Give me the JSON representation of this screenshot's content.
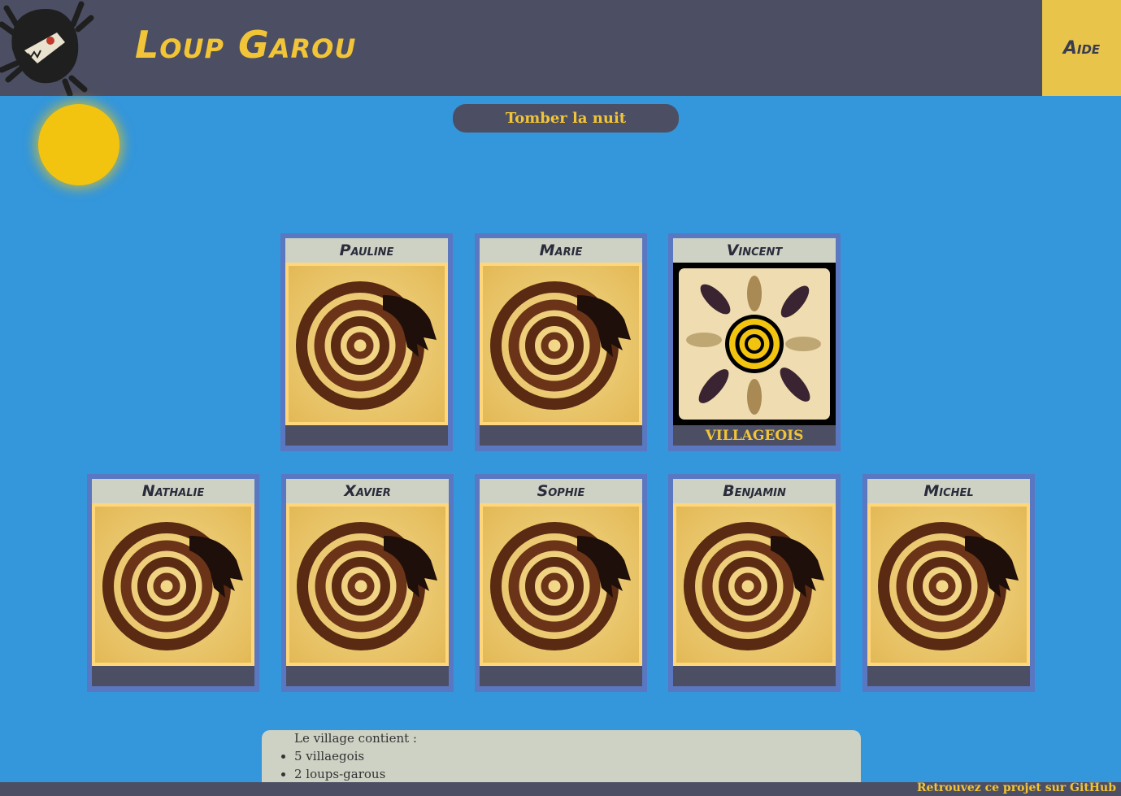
{
  "header": {
    "title": "Loup Garou",
    "help_label": "Aide"
  },
  "controls": {
    "night_button": "Tomber la nuit"
  },
  "players": [
    {
      "name": "Pauline",
      "card": "hidden",
      "role": ""
    },
    {
      "name": "Marie",
      "card": "hidden",
      "role": ""
    },
    {
      "name": "Vincent",
      "card": "villager",
      "role": "VILLAGEOIS"
    },
    {
      "name": "Nathalie",
      "card": "hidden",
      "role": ""
    },
    {
      "name": "Xavier",
      "card": "hidden",
      "role": ""
    },
    {
      "name": "Sophie",
      "card": "hidden",
      "role": ""
    },
    {
      "name": "Benjamin",
      "card": "hidden",
      "role": ""
    },
    {
      "name": "Michel",
      "card": "hidden",
      "role": ""
    }
  ],
  "village_info": {
    "title": "Le village contient :",
    "items": [
      "5 villaegois",
      "2 loups-garous"
    ]
  },
  "footer": {
    "link_text": "Retrouvez ce projet sur GitHub"
  },
  "colors": {
    "sky": "#3496db",
    "header_bg": "#4c4f63",
    "accent_yellow": "#f2c437",
    "sun": "#f2c410",
    "card_frame": "#5a77c2"
  }
}
